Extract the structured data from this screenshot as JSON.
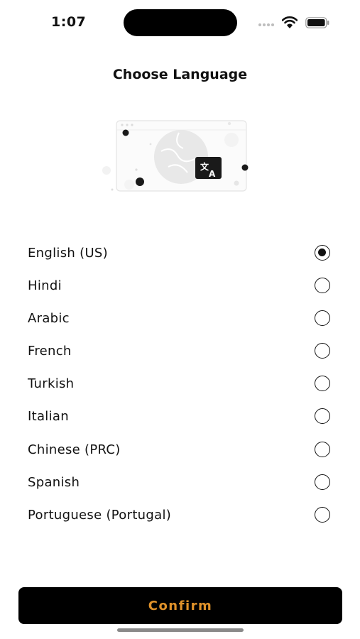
{
  "status_bar": {
    "time": "1:07"
  },
  "header": {
    "title": "Choose Language"
  },
  "illustration": {
    "icon": "translate-icon"
  },
  "languages": [
    {
      "label": "English (US)",
      "selected": true
    },
    {
      "label": "Hindi",
      "selected": false
    },
    {
      "label": "Arabic",
      "selected": false
    },
    {
      "label": "French",
      "selected": false
    },
    {
      "label": "Turkish",
      "selected": false
    },
    {
      "label": "Italian",
      "selected": false
    },
    {
      "label": "Chinese (PRC)",
      "selected": false
    },
    {
      "label": "Spanish",
      "selected": false
    },
    {
      "label": "Portuguese (Portugal)",
      "selected": false
    }
  ],
  "footer": {
    "confirm_label": "Confirm"
  },
  "colors": {
    "accent": "#e0922a",
    "button_bg": "#000000"
  }
}
